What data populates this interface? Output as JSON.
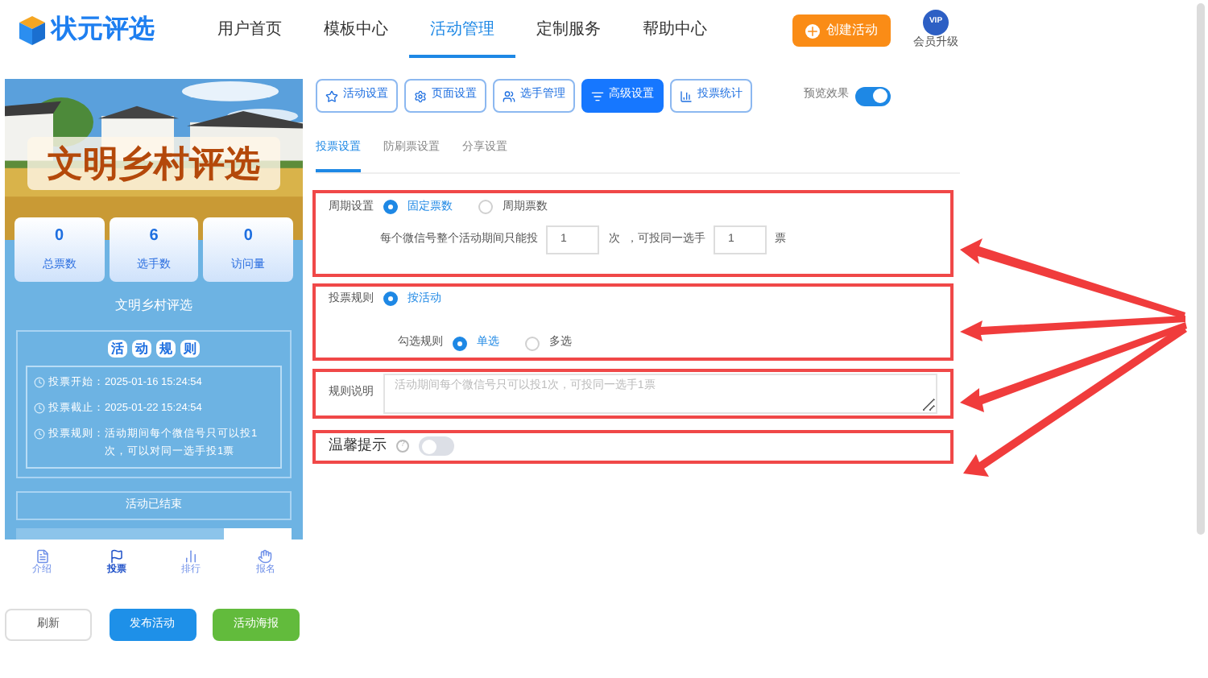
{
  "header": {
    "logo": "状元评选",
    "nav": [
      {
        "label": "用户首页",
        "selected": false
      },
      {
        "label": "模板中心",
        "selected": false
      },
      {
        "label": "活动管理",
        "selected": true
      },
      {
        "label": "定制服务",
        "selected": false
      },
      {
        "label": "帮助中心",
        "selected": false
      }
    ],
    "create_button": "创建活动",
    "vip": {
      "badge": "VIP",
      "label": "会员升级"
    }
  },
  "preview": {
    "banner_title": "文明乡村评选",
    "stats": [
      {
        "value": "0",
        "label": "总票数"
      },
      {
        "value": "6",
        "label": "选手数"
      },
      {
        "value": "0",
        "label": "访问量"
      }
    ],
    "title": "文明乡村评选",
    "rules_heading": [
      "活",
      "动",
      "规",
      "则"
    ],
    "info": [
      {
        "label": "投票开始：",
        "value": "2025-01-16 15:24:54"
      },
      {
        "label": "投票截止：",
        "value": "2025-01-22 15:24:54"
      },
      {
        "label": "投票规则：",
        "value": "活动期间每个微信号只可以投1次，可以对同一选手投1票"
      }
    ],
    "status": "活动已结束",
    "bottom_nav": [
      {
        "label": "介绍",
        "selected": false
      },
      {
        "label": "投票",
        "selected": true
      },
      {
        "label": "排行",
        "selected": false
      },
      {
        "label": "报名",
        "selected": false
      }
    ]
  },
  "actions": [
    {
      "label": "刷新",
      "kind": "outline"
    },
    {
      "label": "发布活动",
      "kind": "blue"
    },
    {
      "label": "活动海报",
      "kind": "green"
    }
  ],
  "toolbar": [
    {
      "label": "活动设置",
      "selected": false
    },
    {
      "label": "页面设置",
      "selected": false
    },
    {
      "label": "选手管理",
      "selected": false
    },
    {
      "label": "高级设置",
      "selected": true
    },
    {
      "label": "投票统计",
      "selected": false
    }
  ],
  "preview_toggle": {
    "label": "预览效果",
    "on": true
  },
  "tabs": [
    {
      "label": "投票设置",
      "selected": true
    },
    {
      "label": "防刷票设置",
      "selected": false
    },
    {
      "label": "分享设置",
      "selected": false
    }
  ],
  "period": {
    "label": "周期设置",
    "options": [
      {
        "label": "固定票数",
        "selected": true
      },
      {
        "label": "周期票数",
        "selected": false
      }
    ],
    "text_1": "每个微信号整个活动期间只能投",
    "value_1": "1",
    "text_2": "次",
    "text_3": "，可投同一选手",
    "value_2": "1",
    "text_4": "票"
  },
  "vote_rule": {
    "label": "投票规则",
    "options": [
      {
        "label": "按活动",
        "selected": true
      }
    ],
    "check_label": "勾选规则",
    "check_options": [
      {
        "label": "单选",
        "selected": true
      },
      {
        "label": "多选",
        "selected": false
      }
    ]
  },
  "rule_desc": {
    "label": "规则说明",
    "placeholder": "活动期间每个微信号只可以投1次，可投同一选手1票"
  },
  "tip": {
    "label": "温馨提示",
    "help": "?",
    "on": false
  }
}
